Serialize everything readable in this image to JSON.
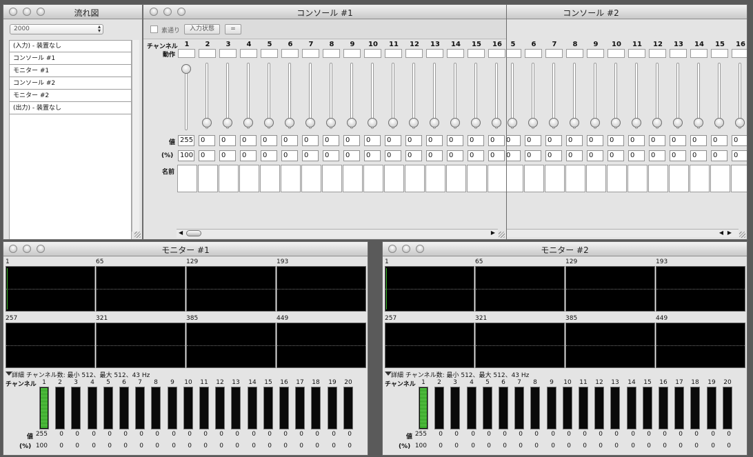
{
  "flow": {
    "title": "流れ図",
    "select_value": "2000",
    "items": [
      "(入力) - 装置なし",
      "コンソール #1",
      "モニター #1",
      "コンソール #2",
      "モニター #2",
      "(出力) - 装置なし"
    ]
  },
  "console1": {
    "title": "コンソール #1",
    "passthrough_label": "素通り",
    "input_state_label": "入力状態",
    "equals_label": "=",
    "channel_header": "チャンネル",
    "action_label": "動作",
    "value_label": "値",
    "percent_label": "(%)",
    "name_label": "名前",
    "channels": [
      "1",
      "2",
      "3",
      "4",
      "5",
      "6",
      "7",
      "8",
      "9",
      "10",
      "11",
      "12",
      "13",
      "14",
      "15",
      "16"
    ],
    "values": [
      "255",
      "0",
      "0",
      "0",
      "0",
      "0",
      "0",
      "0",
      "0",
      "0",
      "0",
      "0",
      "0",
      "0",
      "0",
      "0"
    ],
    "percents": [
      "100",
      "0",
      "0",
      "0",
      "0",
      "0",
      "0",
      "0",
      "0",
      "0",
      "0",
      "0",
      "0",
      "0",
      "0",
      "0"
    ],
    "levels": [
      1,
      0,
      0,
      0,
      0,
      0,
      0,
      0,
      0,
      0,
      0,
      0,
      0,
      0,
      0,
      0
    ]
  },
  "console2": {
    "title": "コンソール #2",
    "channels": [
      "5",
      "6",
      "7",
      "8",
      "9",
      "10",
      "11",
      "12",
      "13",
      "14",
      "15",
      "16"
    ],
    "values": [
      "0",
      "0",
      "0",
      "0",
      "0",
      "0",
      "0",
      "0",
      "0",
      "0",
      "0",
      "0"
    ],
    "percents": [
      "0",
      "0",
      "0",
      "0",
      "0",
      "0",
      "0",
      "0",
      "0",
      "0",
      "0",
      "0"
    ],
    "levels": [
      0,
      0,
      0,
      0,
      0,
      0,
      0,
      0,
      0,
      0,
      0,
      0
    ]
  },
  "monitor1": {
    "title": "モニター #1",
    "display_labels": [
      "1",
      "65",
      "129",
      "193",
      "257",
      "321",
      "385",
      "449"
    ],
    "details_text": "詳細 チャンネル数: 最小 512、最大 512、43 Hz",
    "channel_header": "チャンネル",
    "value_label": "値",
    "percent_label": "(%)",
    "channels": [
      "1",
      "2",
      "3",
      "4",
      "5",
      "6",
      "7",
      "8",
      "9",
      "10",
      "11",
      "12",
      "13",
      "14",
      "15",
      "16",
      "17",
      "18",
      "19",
      "20"
    ],
    "values": [
      "255",
      "0",
      "0",
      "0",
      "0",
      "0",
      "0",
      "0",
      "0",
      "0",
      "0",
      "0",
      "0",
      "0",
      "0",
      "0",
      "0",
      "0",
      "0",
      "0"
    ],
    "percents": [
      "100",
      "0",
      "0",
      "0",
      "0",
      "0",
      "0",
      "0",
      "0",
      "0",
      "0",
      "0",
      "0",
      "0",
      "0",
      "0",
      "0",
      "0",
      "0",
      "0"
    ],
    "levels": [
      1,
      0,
      0,
      0,
      0,
      0,
      0,
      0,
      0,
      0,
      0,
      0,
      0,
      0,
      0,
      0,
      0,
      0,
      0,
      0
    ]
  },
  "monitor2": {
    "title": "モニター #2",
    "display_labels": [
      "1",
      "65",
      "129",
      "193",
      "257",
      "321",
      "385",
      "449"
    ],
    "details_text": "詳細 チャンネル数: 最小 512、最大 512、43 Hz",
    "channel_header": "チャンネル",
    "value_label": "値",
    "percent_label": "(%)",
    "channels": [
      "1",
      "2",
      "3",
      "4",
      "5",
      "6",
      "7",
      "8",
      "9",
      "10",
      "11",
      "12",
      "13",
      "14",
      "15",
      "16",
      "17",
      "18",
      "19",
      "20"
    ],
    "values": [
      "255",
      "0",
      "0",
      "0",
      "0",
      "0",
      "0",
      "0",
      "0",
      "0",
      "0",
      "0",
      "0",
      "0",
      "0",
      "0",
      "0",
      "0",
      "0",
      "0"
    ],
    "percents": [
      "100",
      "0",
      "0",
      "0",
      "0",
      "0",
      "0",
      "0",
      "0",
      "0",
      "0",
      "0",
      "0",
      "0",
      "0",
      "0",
      "0",
      "0",
      "0",
      "0"
    ],
    "levels": [
      1,
      0,
      0,
      0,
      0,
      0,
      0,
      0,
      0,
      0,
      0,
      0,
      0,
      0,
      0,
      0,
      0,
      0,
      0,
      0
    ]
  },
  "colors": {
    "meter_fill": "#3cb82a",
    "display_bg": "#000000",
    "window_bg": "#e4e4e4"
  }
}
